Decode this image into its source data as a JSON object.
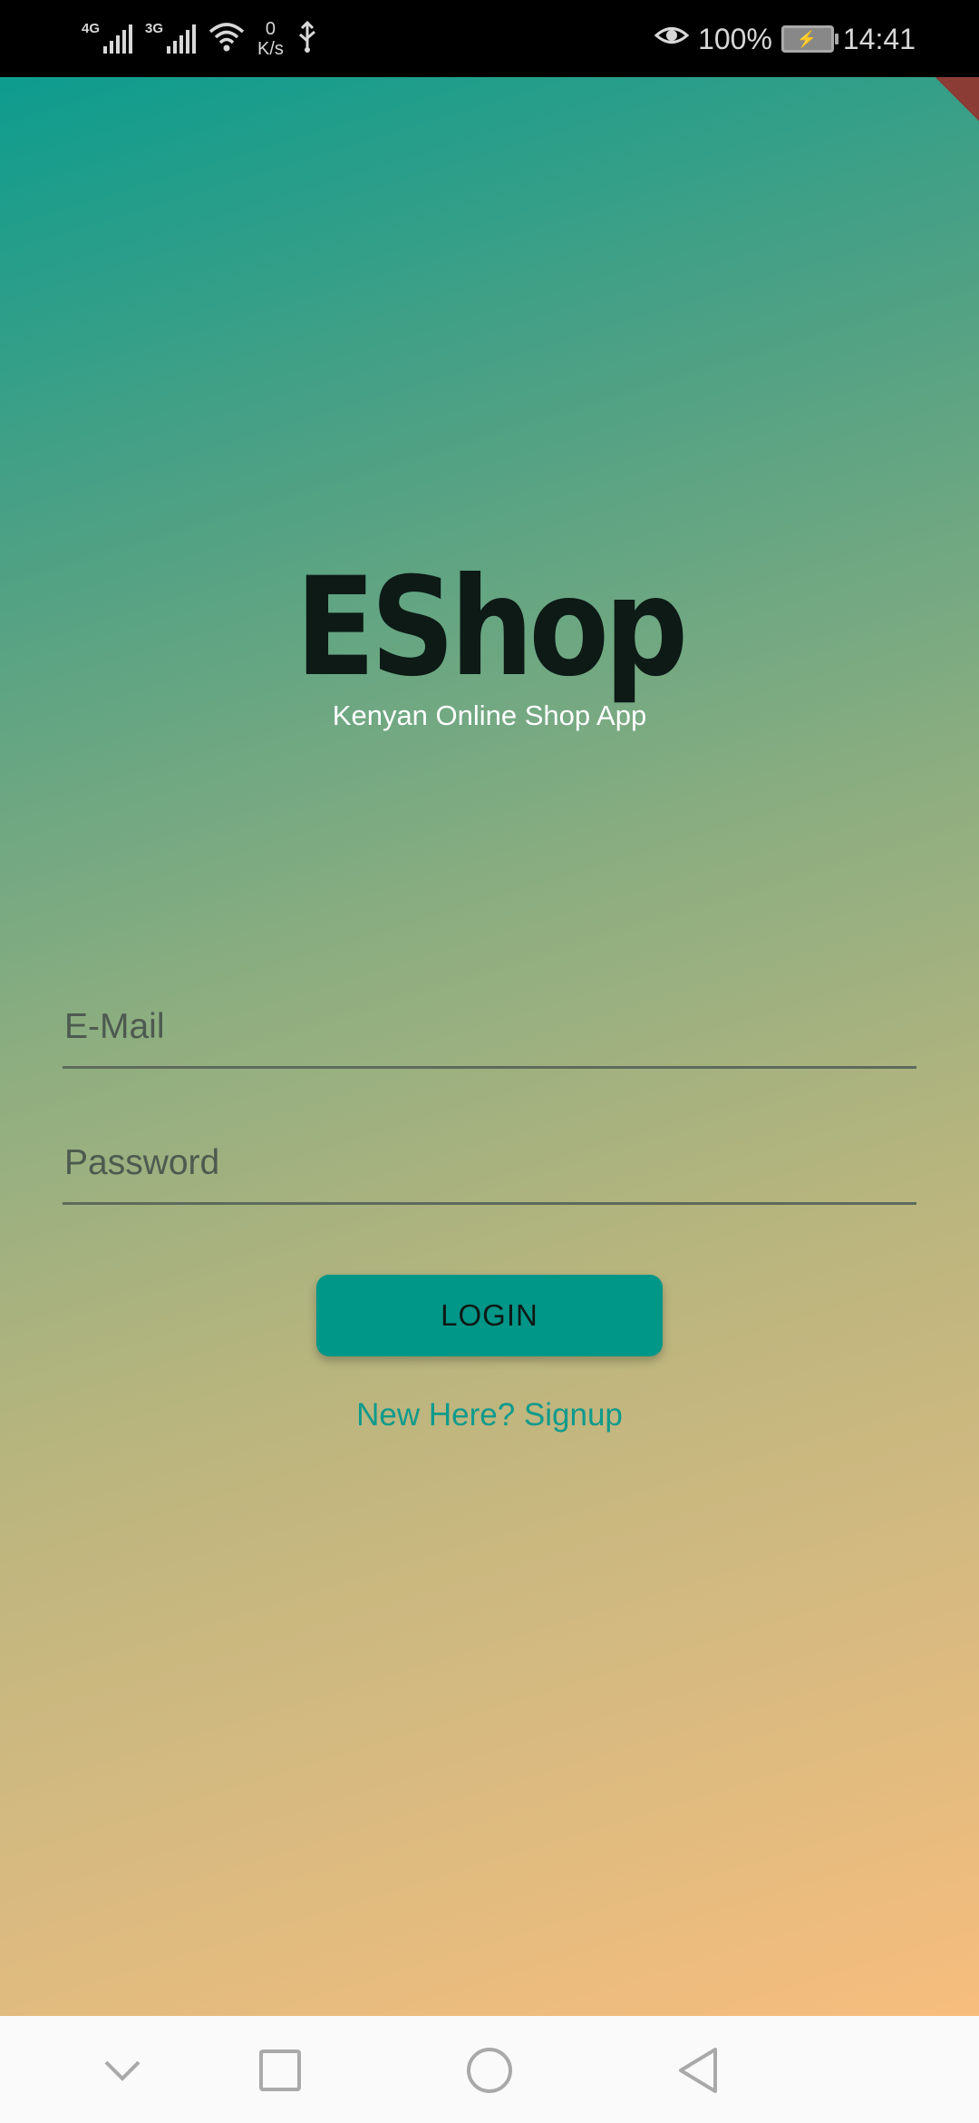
{
  "status_bar": {
    "sim1_type": "4G",
    "sim2_type": "3G",
    "speed_value": "0",
    "speed_unit": "K/s",
    "battery_percent": "100%",
    "time": "14:41",
    "icons": [
      "signal-icon",
      "signal-icon",
      "wifi-icon",
      "usb-icon",
      "eye-icon",
      "battery-icon"
    ]
  },
  "app": {
    "title": "EShop",
    "subtitle": "Kenyan Online Shop App",
    "email_placeholder": "E-Mail",
    "password_placeholder": "Password",
    "login_label": "LOGIN",
    "signup_text": "New Here? Signup"
  },
  "colors": {
    "accent": "#009688",
    "gradient_start": "#0d9c8e",
    "gradient_end": "#f7bd7d",
    "debug_ribbon": "#8a3c35"
  },
  "nav_bar": {
    "icons": [
      "chevron-down-icon",
      "recents-square-icon",
      "home-circle-icon",
      "back-triangle-icon"
    ]
  }
}
